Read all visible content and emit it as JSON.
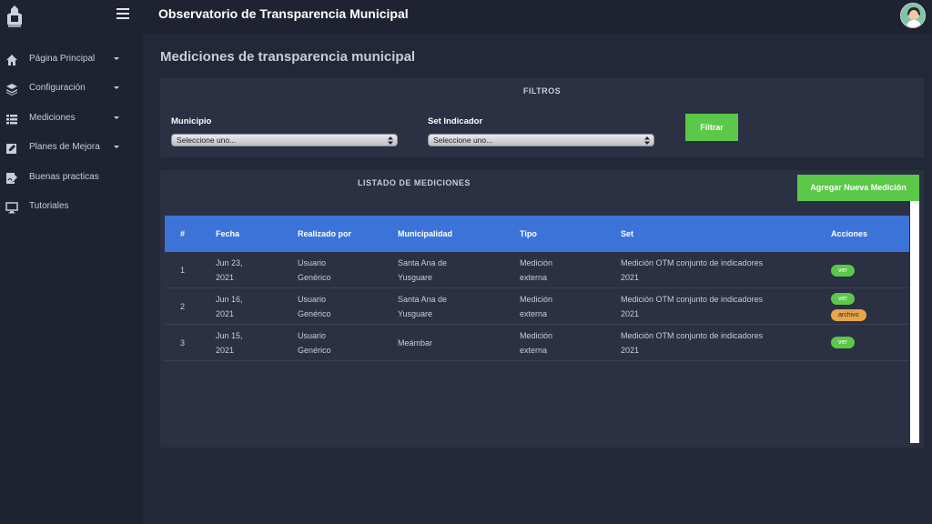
{
  "header": {
    "title": "Observatorio de Transparencia Municipal"
  },
  "sidebar": {
    "items": [
      {
        "label": "Página Principal",
        "icon": "home-icon"
      },
      {
        "label": "Configuración",
        "icon": "layers-icon"
      },
      {
        "label": "Mediciones",
        "icon": "list-icon"
      },
      {
        "label": "Planes de Mejora",
        "icon": "edit-icon"
      },
      {
        "label": "Buenas practicas",
        "icon": "signature-icon"
      },
      {
        "label": "Tutoriales",
        "icon": "monitor-icon"
      }
    ]
  },
  "page": {
    "title": "Mediciones de transparencia municipal"
  },
  "filters": {
    "title": "FILTROS",
    "municipio_label": "Municipio",
    "municipio_value": "Seleccione uno...",
    "set_label": "Set Indicador",
    "set_value": "Seleccione uno...",
    "filter_button": "Filtrar"
  },
  "list": {
    "title": "LISTADO DE MEDICIONES",
    "add_button": "Agregar Nueva Medición",
    "columns": [
      "#",
      "Fecha",
      "Realizado por",
      "Municipalidad",
      "Tipo",
      "Set",
      "Acciones"
    ],
    "rows": [
      {
        "num": "1",
        "fecha": [
          "Jun 23,",
          "2021"
        ],
        "realizado": [
          "Usuario",
          "Genérico"
        ],
        "municipalidad": [
          "Santa Ana de",
          "Yusguare"
        ],
        "tipo": [
          "Medición",
          "externa"
        ],
        "set": [
          "Medición OTM conjunto de indicadores",
          "2021"
        ],
        "actions": [
          "ver"
        ]
      },
      {
        "num": "2",
        "fecha": [
          "Jun 16,",
          "2021"
        ],
        "realizado": [
          "Usuario",
          "Genérico"
        ],
        "municipalidad": [
          "Santa Ana de",
          "Yusguare"
        ],
        "tipo": [
          "Medición",
          "externa"
        ],
        "set": [
          "Medición OTM conjunto de indicadores",
          "2021"
        ],
        "actions": [
          "ver",
          "archivo"
        ]
      },
      {
        "num": "3",
        "fecha": [
          "Jun 15,",
          "2021"
        ],
        "realizado": [
          "Usuario",
          "Genérico"
        ],
        "municipalidad": [
          "Meámbar"
        ],
        "tipo": [
          "Medición",
          "externa"
        ],
        "set": [
          "Medición OTM conjunto de indicadores",
          "2021"
        ],
        "actions": [
          "ver"
        ]
      }
    ]
  },
  "colors": {
    "background": "#232838",
    "panel": "#2b3042",
    "header_blue": "#3b73d9",
    "accent_green": "#5bc84a",
    "badge_orange": "#e8a54a"
  }
}
